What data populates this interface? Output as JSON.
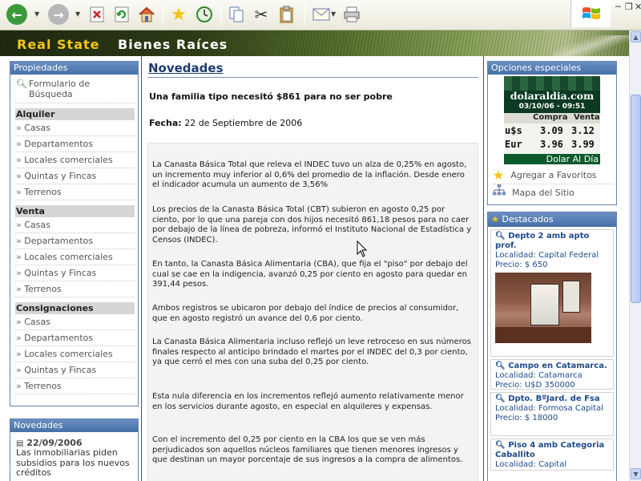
{
  "browser": {
    "buttons": [
      "back-icon",
      "forward-icon",
      "stop-icon",
      "refresh-icon",
      "home-icon",
      "favorites-icon",
      "history-icon",
      "copy-icon",
      "cut-icon",
      "paste-icon",
      "mail-icon",
      "print-icon"
    ]
  },
  "banner": {
    "brand_en": "Real State",
    "brand_es": "Bienes Raíces"
  },
  "left": {
    "propiedades_header": "Propiedades",
    "search_link": "Formulario de Búsqueda",
    "sections": [
      {
        "title": "Alquiler",
        "items": [
          "Casas",
          "Departamentos",
          "Locales comerciales",
          "Quintas y Fincas",
          "Terrenos"
        ]
      },
      {
        "title": "Venta",
        "items": [
          "Casas",
          "Departamentos",
          "Locales comerciales",
          "Quintas y Fincas",
          "Terrenos"
        ]
      },
      {
        "title": "Consignaciones",
        "items": [
          "Casas",
          "Departamentos",
          "Locales comerciales",
          "Quintas y Fincas",
          "Terrenos"
        ]
      }
    ],
    "raquo": "»",
    "novedades_header": "Novedades",
    "novedad_date": "22/09/2006",
    "novedad_text": "Las inmobiliarias piden subsidios para los nuevos créditos"
  },
  "center": {
    "title": "Novedades",
    "headline": "Una familia tipo necesitó $861 para no ser pobre",
    "date_label": "Fecha:",
    "date_value": "22 de Septiembre de 2006",
    "paragraphs": [
      "La Canasta Básica Total que releva el INDEC tuvo un alza de 0,25% en agosto, un incremento muy inferior al 0,6% del promedio de la inflación. Desde enero el indicador acumula un aumento de 3,56%",
      "Los precios de la Canasta Básica Total (CBT) subieron en agosto 0,25 por ciento, por lo que una pareja con dos hijos necesitó 861,18 pesos para no caer por debajo de la línea de pobreza, informó el Instituto Nacional de Estadística y Censos (INDEC).",
      "En tanto, la Canasta Básica Alimentaria (CBA), que fija el \"piso\" por debajo del cual se cae en la indigencia, avanzó 0,25 por ciento en agosto para quedar en 391,44 pesos.",
      "Ambos registros se ubicaron por debajo del índice de precios al consumidor, que en agosto registró un avance del 0,6 por ciento.",
      "La Canasta Básica Alimentaria incluso reflejó un leve retroceso en sus números finales respecto al anticipo brindado el martes por el INDEC del 0,3 por ciento, ya que cerró el mes con una suba del 0,25 por ciento.",
      "Esta nula diferencia en los incrementos reflejó aumento relativamente menor en los servicios durante agosto, en especial en alquileres y expensas.",
      "Con el incremento del 0,25 por ciento en la CBA los que se ven más perjudicados son aquellos núcleos familiares que tienen menores ingresos y que destinan un mayor porcentaje de sus ingresos a la compra de alimentos."
    ]
  },
  "right": {
    "opciones_header": "Opciones especiales",
    "dolar": {
      "site": "dolaraldia.com",
      "datetime": "03/10/06 - 09:51",
      "col_compra": "Compra",
      "col_venta": "Venta",
      "rows": [
        {
          "currency": "u$s",
          "compra": "3.09",
          "venta": "3.12"
        },
        {
          "currency": "Eur",
          "compra": "3.96",
          "venta": "3.99"
        }
      ],
      "footer": "Dolar Al Día"
    },
    "favoritos": "Agregar a Favoritos",
    "mapa": "Mapa del Sitio",
    "destacados_header": "Destacados",
    "destacados": [
      {
        "title": "Depto 2 amb apto prof.",
        "localidad": "Localidad: Capital Federal",
        "precio": "Precio: $ 650"
      },
      {
        "title": "Campo en Catamarca.",
        "localidad": "Localidad: Catamarca",
        "precio": "Precio: U$D 350000"
      },
      {
        "title": "Dpto. BºJard. de Fsa",
        "localidad": "Localidad: Formosa Capital",
        "precio": "Precio: $ 18000"
      },
      {
        "title": "Piso 4 amb Categoria Caballito",
        "localidad": "Localidad: Capital"
      }
    ]
  },
  "colors": {
    "panel_border": "#5e84b6",
    "link_blue": "#1e4a8c",
    "brand_yellow": "#f5c518"
  }
}
